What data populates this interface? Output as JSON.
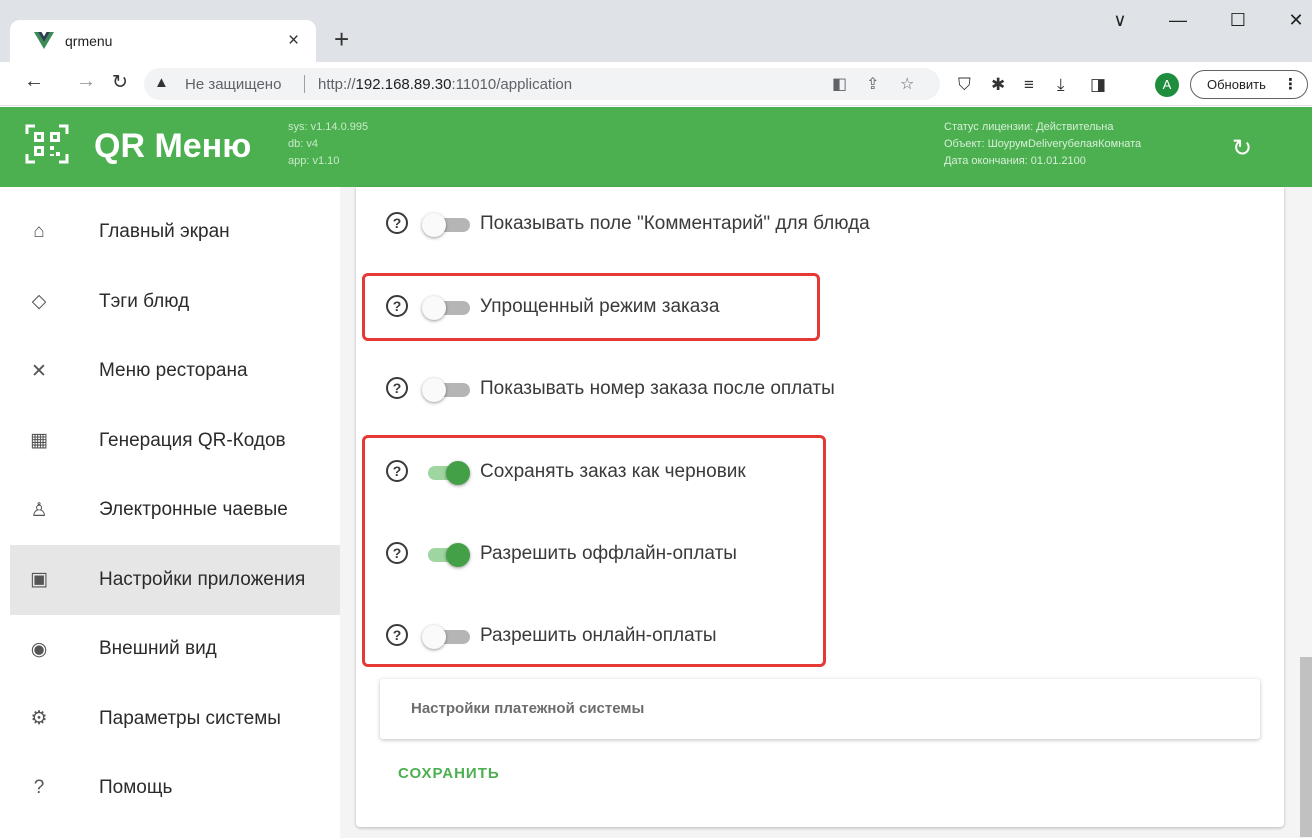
{
  "browser": {
    "tab_title": "qrmenu",
    "tab_close": "×",
    "new_tab": "+",
    "window_controls": {
      "chevron": "∨",
      "minimize": "—",
      "maximize": "☐",
      "close": "✕"
    },
    "security_label": "Не защищено",
    "url_prefix": "http://",
    "url_host": "192.168.89.30",
    "url_rest": ":11010/application",
    "avatar_letter": "A",
    "update_label": "Обновить",
    "menu_dots": "⋮"
  },
  "header": {
    "brand": "QR Меню",
    "versions": [
      "sys: v1.14.0.995",
      "db: v4",
      "app: v1.10"
    ],
    "license_status": "Статус лицензии: Действительна",
    "license_object": "Объект: ШоурумDeliveryбелаяКомната",
    "license_expiry": "Дата окончания: 01.01.2100",
    "accent_color": "#4caf50"
  },
  "sidebar": {
    "items": [
      {
        "label": "Главный экран",
        "icon": "home-icon",
        "glyph": "⌂"
      },
      {
        "label": "Тэги блюд",
        "icon": "tag-icon",
        "glyph": "◇"
      },
      {
        "label": "Меню ресторана",
        "icon": "utensils-icon",
        "glyph": "✕"
      },
      {
        "label": "Генерация QR-Кодов",
        "icon": "qr-code-icon",
        "glyph": "▦"
      },
      {
        "label": "Электронные чаевые",
        "icon": "tips-hand-icon",
        "glyph": "♙"
      },
      {
        "label": "Настройки приложения",
        "icon": "app-settings-icon",
        "glyph": "▣",
        "active": true
      },
      {
        "label": "Внешний вид",
        "icon": "eye-icon",
        "glyph": "◉"
      },
      {
        "label": "Параметры системы",
        "icon": "gear-icon",
        "glyph": "⚙"
      },
      {
        "label": "Помощь",
        "icon": "help-circle-icon",
        "glyph": "?"
      }
    ]
  },
  "settings": [
    {
      "label": "Показывать поле \"Комментарий\" для блюда",
      "enabled": false
    },
    {
      "label": "Упрощенный режим заказа",
      "enabled": false
    },
    {
      "label": "Показывать номер заказа после оплаты",
      "enabled": false
    },
    {
      "label": "Сохранять заказ как черновик",
      "enabled": true
    },
    {
      "label": "Разрешить оффлайн-оплаты",
      "enabled": true
    },
    {
      "label": "Разрешить онлайн-оплаты",
      "enabled": false
    }
  ],
  "help_glyph": "?",
  "payment_panel_title": "Настройки платежной системы",
  "save_label": "СОХРАНИТЬ",
  "highlight_color": "#e53935"
}
